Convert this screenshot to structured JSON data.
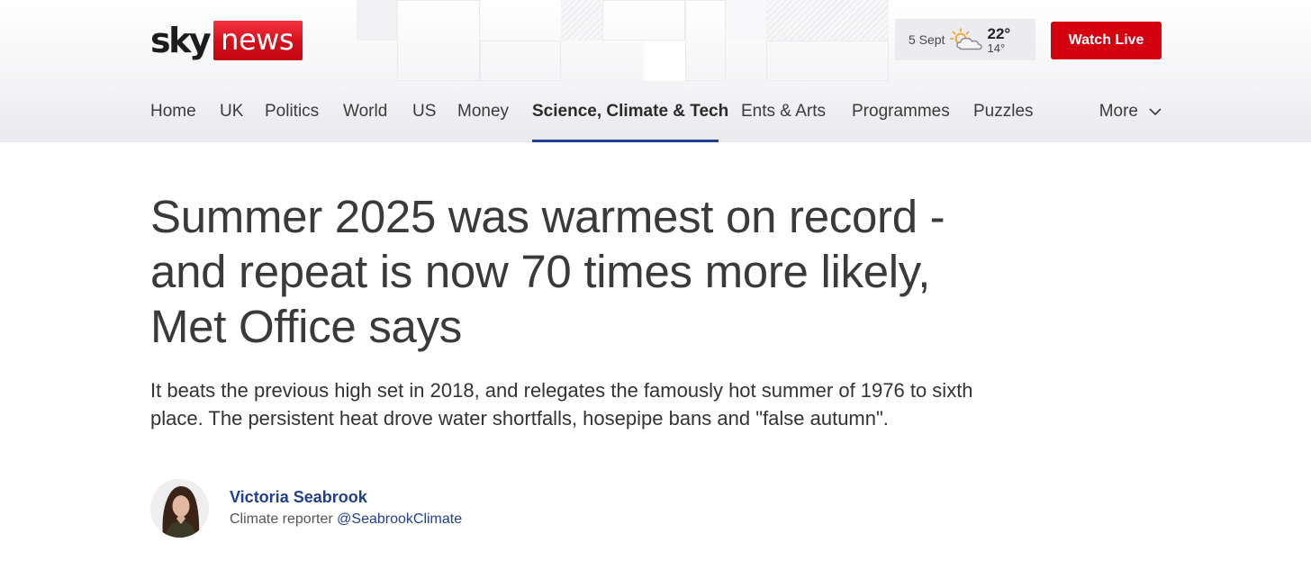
{
  "brand": {
    "logo_sky": "sky",
    "logo_news": "news"
  },
  "weather": {
    "date": "5 Sept",
    "high": "22°",
    "low": "14°",
    "icon": "sun-cloud-icon"
  },
  "header": {
    "watch_live_label": "Watch Live"
  },
  "nav": {
    "items": [
      {
        "label": "Home"
      },
      {
        "label": "UK"
      },
      {
        "label": "Politics"
      },
      {
        "label": "World"
      },
      {
        "label": "US"
      },
      {
        "label": "Money"
      },
      {
        "label": "Science, Climate & Tech",
        "active": true
      },
      {
        "label": "Ents & Arts"
      },
      {
        "label": "Programmes"
      },
      {
        "label": "Puzzles"
      }
    ],
    "more_label": "More"
  },
  "article": {
    "headline": "Summer 2025 was warmest on record - and repeat is now 70 times more likely, Met Office says",
    "standfirst": "It beats the previous high set in 2018, and relegates the famously hot summer of 1976 to sixth place. The persistent heat drove water shortfalls, hosepipe bans and \"false autumn\".",
    "author": {
      "name": "Victoria Seabrook",
      "role": "Climate reporter",
      "handle": "@SeabrookClimate"
    }
  },
  "colors": {
    "brand_red": "#d4000f",
    "link_blue": "#213f8c",
    "active_underline": "#213f8c"
  }
}
